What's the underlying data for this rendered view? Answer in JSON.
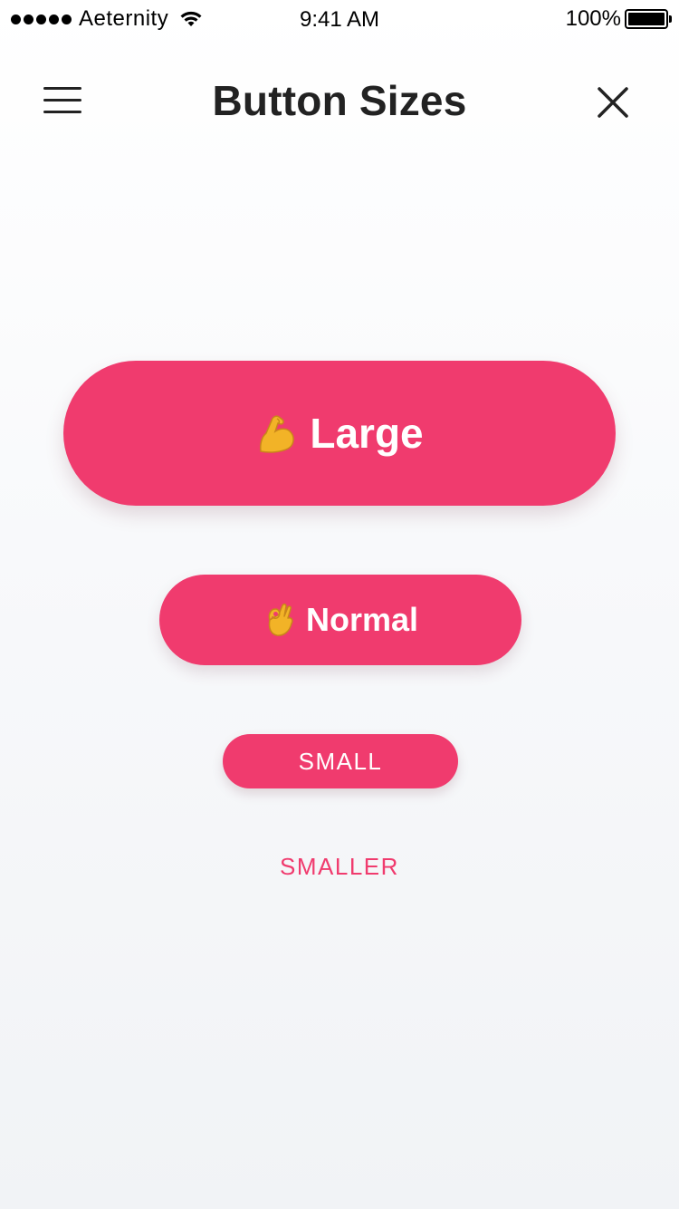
{
  "status_bar": {
    "carrier": "Aeternity",
    "time": "9:41 AM",
    "battery": "100%"
  },
  "nav": {
    "title": "Button Sizes",
    "menu_icon": "hamburger-menu-icon",
    "close_icon": "close-icon"
  },
  "buttons": {
    "large": {
      "emoji": "flexed-biceps-icon",
      "label": "Large"
    },
    "normal": {
      "emoji": "ok-hand-icon",
      "label": "Normal"
    },
    "small": {
      "label": "SMALL"
    },
    "smaller": {
      "label": "SMALLER"
    }
  },
  "colors": {
    "accent": "#f03b6e",
    "title": "#222222",
    "background_top": "#ffffff",
    "background_bottom": "#f1f3f6"
  }
}
